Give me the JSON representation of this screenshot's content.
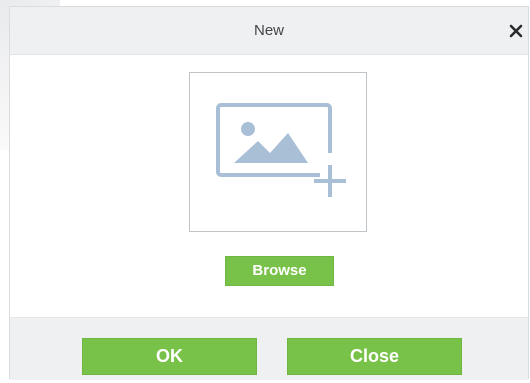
{
  "dialog": {
    "title": "New",
    "close_icon": "close-icon",
    "photo_placeholder_icon": "image-add-icon",
    "browse_label": "Browse"
  },
  "footer": {
    "ok_label": "OK",
    "close_label": "Close"
  },
  "colors": {
    "accent_green": "#79c24a",
    "header_bg": "#eef0f2",
    "icon_blue": "#a9bfd6"
  }
}
